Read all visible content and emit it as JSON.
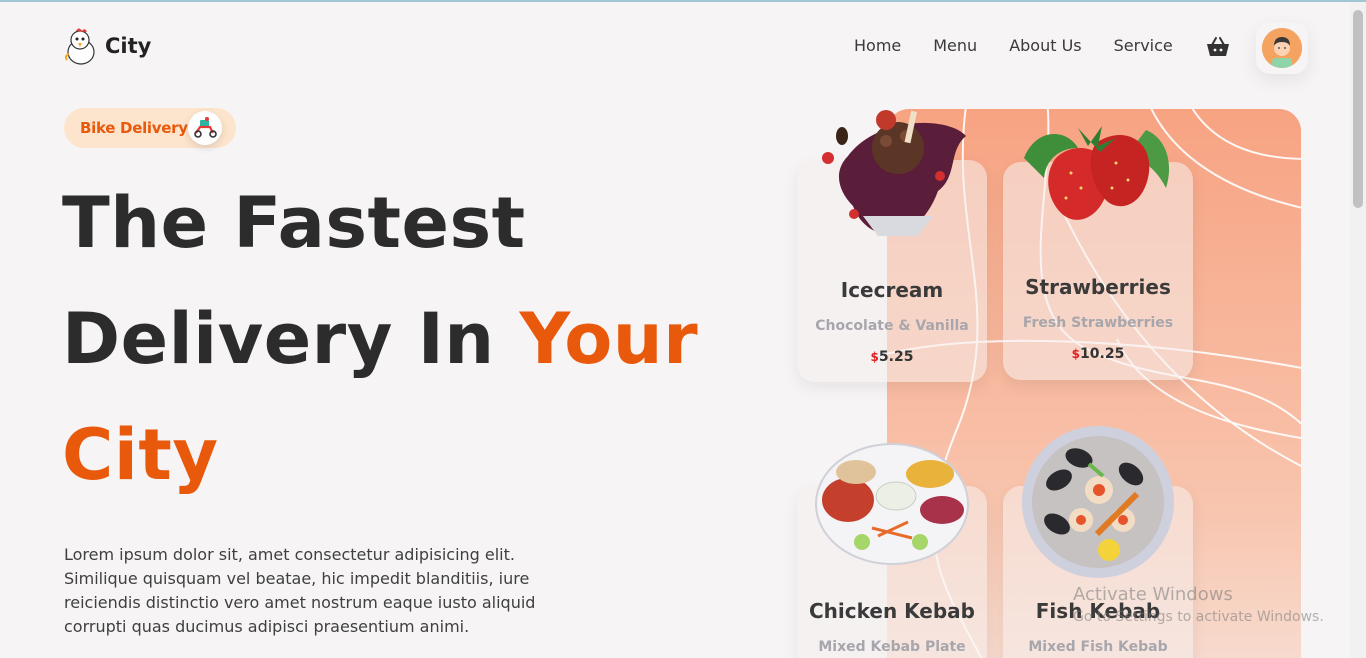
{
  "brand": {
    "name": "City"
  },
  "nav": {
    "items": [
      "Home",
      "Menu",
      "About Us",
      "Service"
    ]
  },
  "hero": {
    "badge": "Bike Delivery",
    "line1": "The Fastest",
    "line2_plain": "Delivery In ",
    "line2_accent": "Your",
    "line3_accent": "City",
    "description": "Lorem ipsum dolor sit, amet consectetur adipisicing elit. Similique quisquam vel beatae, hic impedit blanditiis, iure reiciendis distinctio vero amet nostrum eaque iusto aliquid corrupti quas ducimus adipisci praesentium animi."
  },
  "cards": [
    {
      "name": "Icecream",
      "sub": "Chocolate & Vanilla",
      "currency": "$",
      "price": "5.25"
    },
    {
      "name": "Strawberries",
      "sub": "Fresh Strawberries",
      "currency": "$",
      "price": "10.25"
    },
    {
      "name": "Chicken Kebab",
      "sub": "Mixed Kebab Plate"
    },
    {
      "name": "Fish Kebab",
      "sub": "Mixed Fish Kebab"
    }
  ],
  "watermark": {
    "title": "Activate Windows",
    "subtitle": "Go to Settings to activate Windows."
  },
  "colors": {
    "accent": "#e8590c",
    "panel": "#f7a382",
    "badge_bg": "#fde4cc"
  },
  "icons": [
    "chicken-logo-icon",
    "basket-icon",
    "avatar-icon",
    "scooter-icon"
  ]
}
